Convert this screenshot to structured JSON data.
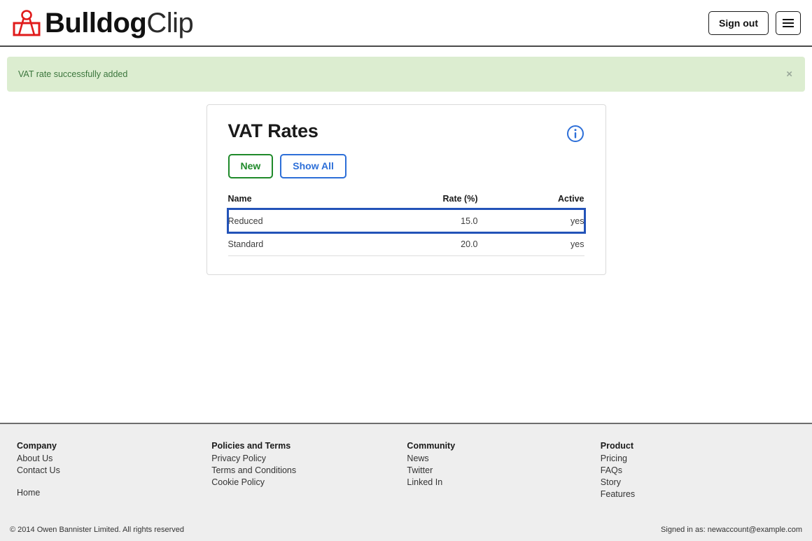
{
  "header": {
    "brand_bold": "Bulldog",
    "brand_light": "Clip",
    "logo_icon": "binder-clip-icon",
    "sign_out_label": "Sign out",
    "menu_icon": "hamburger-menu-icon",
    "brand_accent_color": "#e01b1b"
  },
  "alert": {
    "message": "VAT rate successfully added",
    "close_label": "×",
    "background_color": "#dcedd0",
    "text_color": "#3c763d"
  },
  "card": {
    "title": "VAT Rates",
    "info_icon": "info-circle-icon",
    "new_label": "New",
    "show_all_label": "Show All",
    "new_color": "#1f8a2a",
    "show_all_color": "#2d6fd8",
    "focus_color": "#2353b8",
    "table": {
      "columns": [
        "Name",
        "Rate (%)",
        "Active"
      ],
      "rows": [
        {
          "name": "Reduced",
          "rate": "15.0",
          "active": "yes",
          "focused": true
        },
        {
          "name": "Standard",
          "rate": "20.0",
          "active": "yes",
          "focused": false
        }
      ]
    }
  },
  "footer": {
    "columns": [
      {
        "heading": "Company",
        "links": [
          "About Us",
          "Contact Us"
        ],
        "extra_links": [
          "Home"
        ]
      },
      {
        "heading": "Policies and Terms",
        "links": [
          "Privacy Policy",
          "Terms and Conditions",
          "Cookie Policy"
        ],
        "extra_links": []
      },
      {
        "heading": "Community",
        "links": [
          "News",
          "Twitter",
          "Linked In"
        ],
        "extra_links": []
      },
      {
        "heading": "Product",
        "links": [
          "Pricing",
          "FAQs",
          "Story",
          "Features"
        ],
        "extra_links": []
      }
    ],
    "copyright": "© 2014 Owen Bannister Limited. All rights reserved",
    "signed_in_as": "Signed in as: newaccount@example.com"
  }
}
